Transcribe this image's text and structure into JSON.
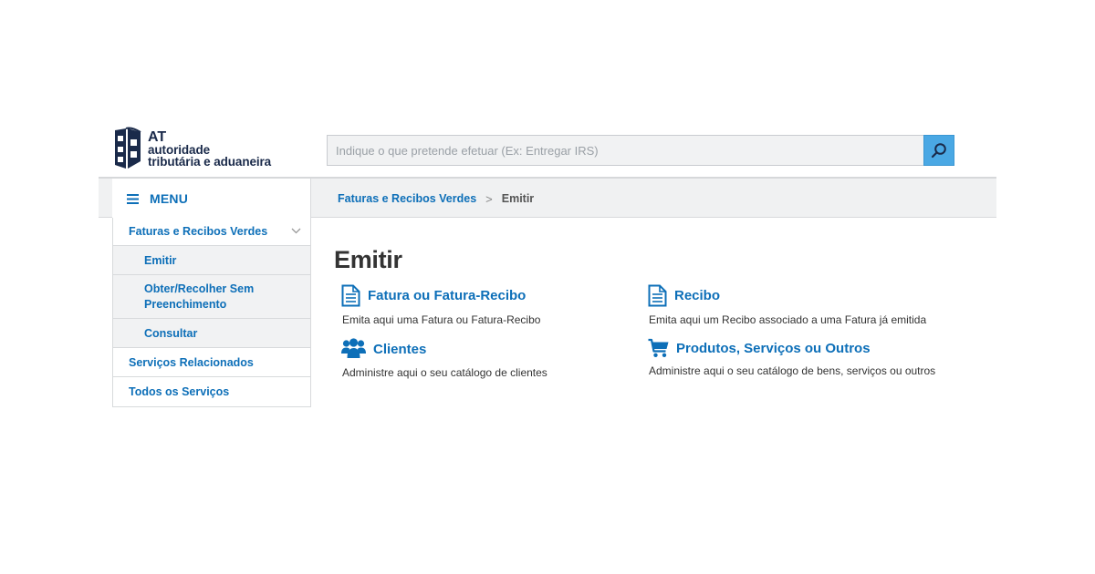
{
  "logo": {
    "abbr": "AT",
    "line1": "autoridade",
    "line2": "tributária e aduaneira"
  },
  "search": {
    "placeholder": "Indique o que pretende efetuar (Ex: Entregar IRS)",
    "value": ""
  },
  "menu": {
    "label": "MENU"
  },
  "breadcrumb": {
    "parent": "Faturas e Recibos Verdes",
    "separator": ">",
    "current": "Emitir"
  },
  "sidebar": {
    "items": [
      {
        "label": "Faturas e Recibos Verdes"
      },
      {
        "label": "Emitir"
      },
      {
        "label": "Obter/Recolher Sem Preenchimento"
      },
      {
        "label": "Consultar"
      },
      {
        "label": "Serviços Relacionados"
      },
      {
        "label": "Todos os Serviços"
      }
    ]
  },
  "main": {
    "title": "Emitir",
    "cards": [
      {
        "icon": "document-icon",
        "title": "Fatura ou Fatura-Recibo",
        "desc": "Emita aqui uma Fatura ou Fatura-Recibo"
      },
      {
        "icon": "document-icon",
        "title": "Recibo",
        "desc": "Emita aqui um Recibo associado a uma Fatura já emitida"
      },
      {
        "icon": "users-icon",
        "title": "Clientes",
        "desc": "Administre aqui o seu catálogo de clientes"
      },
      {
        "icon": "cart-icon",
        "title": "Produtos, Serviços ou Outros",
        "desc": "Administre aqui o seu catálogo de bens, serviços ou outros"
      }
    ]
  },
  "colors": {
    "link": "#0d6fb8",
    "search_button": "#4aa8e4",
    "bar_bg": "#f0f1f2",
    "logo_dark": "#1a2a4a"
  }
}
